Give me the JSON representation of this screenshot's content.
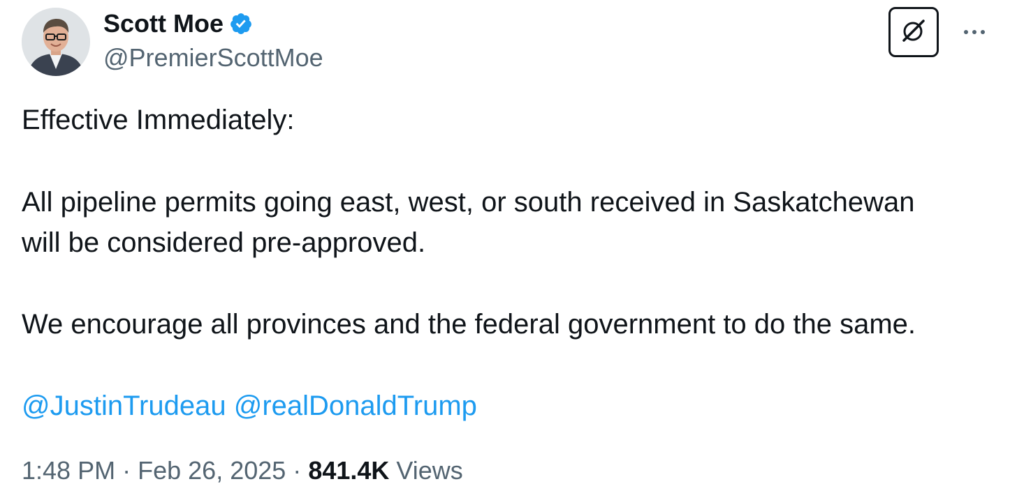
{
  "author": {
    "display_name": "Scott Moe",
    "handle": "@PremierScottMoe",
    "verified": true,
    "verified_color": "#1d9bf0"
  },
  "header_actions": {
    "grok_icon": "grok-icon",
    "more_icon": "more-horizontal-icon"
  },
  "tweet": {
    "lines": [
      "Effective Immediately:",
      "All pipeline permits going east, west, or south received in Saskatchewan",
      "will be considered pre-approved.",
      "We encourage all provinces and the federal government to do the same."
    ],
    "mentions": [
      "@JustinTrudeau",
      "@realDonaldTrump"
    ],
    "mention_color": "#1d9bf0"
  },
  "meta": {
    "time": "1:48 PM",
    "separator": "·",
    "date": "Feb 26, 2025",
    "views_count": "841.4K",
    "views_label": "Views"
  }
}
